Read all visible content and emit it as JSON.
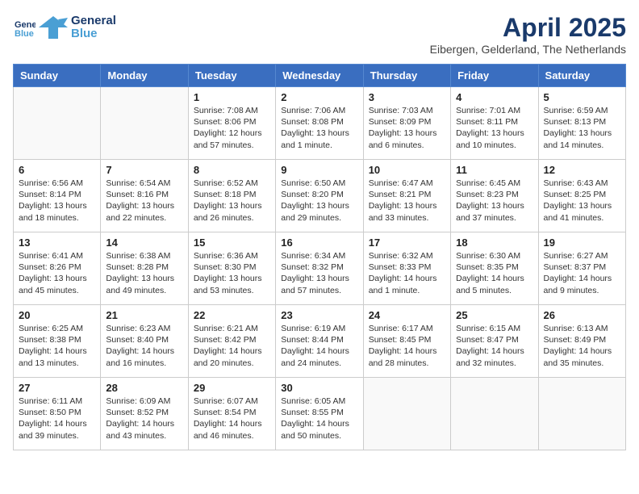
{
  "header": {
    "logo_line1": "General",
    "logo_line2": "Blue",
    "month_title": "April 2025",
    "location": "Eibergen, Gelderland, The Netherlands"
  },
  "days_of_week": [
    "Sunday",
    "Monday",
    "Tuesday",
    "Wednesday",
    "Thursday",
    "Friday",
    "Saturday"
  ],
  "weeks": [
    [
      {
        "day": "",
        "info": ""
      },
      {
        "day": "",
        "info": ""
      },
      {
        "day": "1",
        "info": "Sunrise: 7:08 AM\nSunset: 8:06 PM\nDaylight: 12 hours\nand 57 minutes."
      },
      {
        "day": "2",
        "info": "Sunrise: 7:06 AM\nSunset: 8:08 PM\nDaylight: 13 hours\nand 1 minute."
      },
      {
        "day": "3",
        "info": "Sunrise: 7:03 AM\nSunset: 8:09 PM\nDaylight: 13 hours\nand 6 minutes."
      },
      {
        "day": "4",
        "info": "Sunrise: 7:01 AM\nSunset: 8:11 PM\nDaylight: 13 hours\nand 10 minutes."
      },
      {
        "day": "5",
        "info": "Sunrise: 6:59 AM\nSunset: 8:13 PM\nDaylight: 13 hours\nand 14 minutes."
      }
    ],
    [
      {
        "day": "6",
        "info": "Sunrise: 6:56 AM\nSunset: 8:14 PM\nDaylight: 13 hours\nand 18 minutes."
      },
      {
        "day": "7",
        "info": "Sunrise: 6:54 AM\nSunset: 8:16 PM\nDaylight: 13 hours\nand 22 minutes."
      },
      {
        "day": "8",
        "info": "Sunrise: 6:52 AM\nSunset: 8:18 PM\nDaylight: 13 hours\nand 26 minutes."
      },
      {
        "day": "9",
        "info": "Sunrise: 6:50 AM\nSunset: 8:20 PM\nDaylight: 13 hours\nand 29 minutes."
      },
      {
        "day": "10",
        "info": "Sunrise: 6:47 AM\nSunset: 8:21 PM\nDaylight: 13 hours\nand 33 minutes."
      },
      {
        "day": "11",
        "info": "Sunrise: 6:45 AM\nSunset: 8:23 PM\nDaylight: 13 hours\nand 37 minutes."
      },
      {
        "day": "12",
        "info": "Sunrise: 6:43 AM\nSunset: 8:25 PM\nDaylight: 13 hours\nand 41 minutes."
      }
    ],
    [
      {
        "day": "13",
        "info": "Sunrise: 6:41 AM\nSunset: 8:26 PM\nDaylight: 13 hours\nand 45 minutes."
      },
      {
        "day": "14",
        "info": "Sunrise: 6:38 AM\nSunset: 8:28 PM\nDaylight: 13 hours\nand 49 minutes."
      },
      {
        "day": "15",
        "info": "Sunrise: 6:36 AM\nSunset: 8:30 PM\nDaylight: 13 hours\nand 53 minutes."
      },
      {
        "day": "16",
        "info": "Sunrise: 6:34 AM\nSunset: 8:32 PM\nDaylight: 13 hours\nand 57 minutes."
      },
      {
        "day": "17",
        "info": "Sunrise: 6:32 AM\nSunset: 8:33 PM\nDaylight: 14 hours\nand 1 minute."
      },
      {
        "day": "18",
        "info": "Sunrise: 6:30 AM\nSunset: 8:35 PM\nDaylight: 14 hours\nand 5 minutes."
      },
      {
        "day": "19",
        "info": "Sunrise: 6:27 AM\nSunset: 8:37 PM\nDaylight: 14 hours\nand 9 minutes."
      }
    ],
    [
      {
        "day": "20",
        "info": "Sunrise: 6:25 AM\nSunset: 8:38 PM\nDaylight: 14 hours\nand 13 minutes."
      },
      {
        "day": "21",
        "info": "Sunrise: 6:23 AM\nSunset: 8:40 PM\nDaylight: 14 hours\nand 16 minutes."
      },
      {
        "day": "22",
        "info": "Sunrise: 6:21 AM\nSunset: 8:42 PM\nDaylight: 14 hours\nand 20 minutes."
      },
      {
        "day": "23",
        "info": "Sunrise: 6:19 AM\nSunset: 8:44 PM\nDaylight: 14 hours\nand 24 minutes."
      },
      {
        "day": "24",
        "info": "Sunrise: 6:17 AM\nSunset: 8:45 PM\nDaylight: 14 hours\nand 28 minutes."
      },
      {
        "day": "25",
        "info": "Sunrise: 6:15 AM\nSunset: 8:47 PM\nDaylight: 14 hours\nand 32 minutes."
      },
      {
        "day": "26",
        "info": "Sunrise: 6:13 AM\nSunset: 8:49 PM\nDaylight: 14 hours\nand 35 minutes."
      }
    ],
    [
      {
        "day": "27",
        "info": "Sunrise: 6:11 AM\nSunset: 8:50 PM\nDaylight: 14 hours\nand 39 minutes."
      },
      {
        "day": "28",
        "info": "Sunrise: 6:09 AM\nSunset: 8:52 PM\nDaylight: 14 hours\nand 43 minutes."
      },
      {
        "day": "29",
        "info": "Sunrise: 6:07 AM\nSunset: 8:54 PM\nDaylight: 14 hours\nand 46 minutes."
      },
      {
        "day": "30",
        "info": "Sunrise: 6:05 AM\nSunset: 8:55 PM\nDaylight: 14 hours\nand 50 minutes."
      },
      {
        "day": "",
        "info": ""
      },
      {
        "day": "",
        "info": ""
      },
      {
        "day": "",
        "info": ""
      }
    ]
  ]
}
